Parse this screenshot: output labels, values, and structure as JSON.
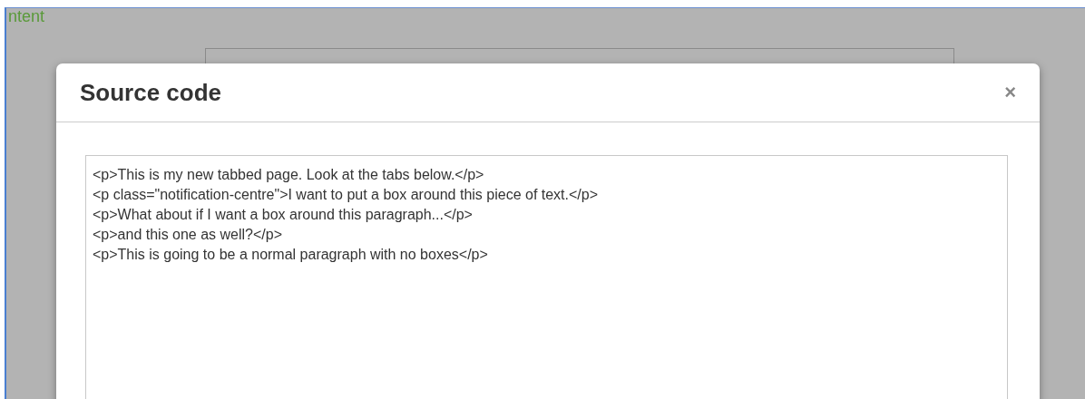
{
  "page": {
    "heading": "ntent"
  },
  "dialog": {
    "title": "Source code",
    "close": "×",
    "code_lines": [
      "<p>This is my new tabbed page. Look at the tabs below.</p>",
      "<p class=\"notification-centre\">I want to put a box around this piece of text.</p>",
      "<p>What about if I want a box around this paragraph...</p>",
      "<p>and this one as well?</p>",
      "<p>This is going to be a normal paragraph with no boxes</p>"
    ]
  }
}
